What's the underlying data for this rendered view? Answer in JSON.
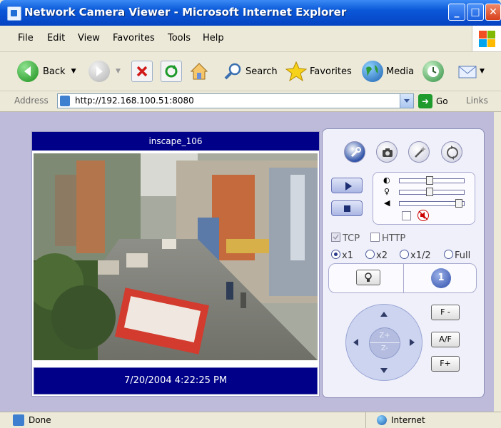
{
  "window": {
    "title": "Network Camera Viewer - Microsoft Internet Explorer"
  },
  "menu": {
    "file": "File",
    "edit": "Edit",
    "view": "View",
    "favorites": "Favorites",
    "tools": "Tools",
    "help": "Help"
  },
  "toolbar": {
    "back": "Back",
    "search": "Search",
    "favorites": "Favorites",
    "media": "Media"
  },
  "address": {
    "label": "Address",
    "url": "http://192.168.100.51:8080",
    "go": "Go",
    "links": "Links"
  },
  "camera": {
    "name": "inscape_106",
    "timestamp": "7/20/2004 4:22:25 PM"
  },
  "panel": {
    "tcp": "TCP",
    "http": "HTTP",
    "tcp_checked": true,
    "http_checked": false,
    "zoom_options": [
      "x1",
      "x2",
      "x1/2",
      "Full"
    ],
    "zoom_selected": "x1",
    "preset_number": "1",
    "zoom_in": "Z+",
    "zoom_out": "Z-",
    "focus_minus": "F -",
    "auto_focus": "A/F",
    "focus_plus": "F+",
    "brightness_level": 0.45,
    "contrast_level": 0.45,
    "volume_level": 0.95
  },
  "status": {
    "text": "Done",
    "zone": "Internet"
  }
}
